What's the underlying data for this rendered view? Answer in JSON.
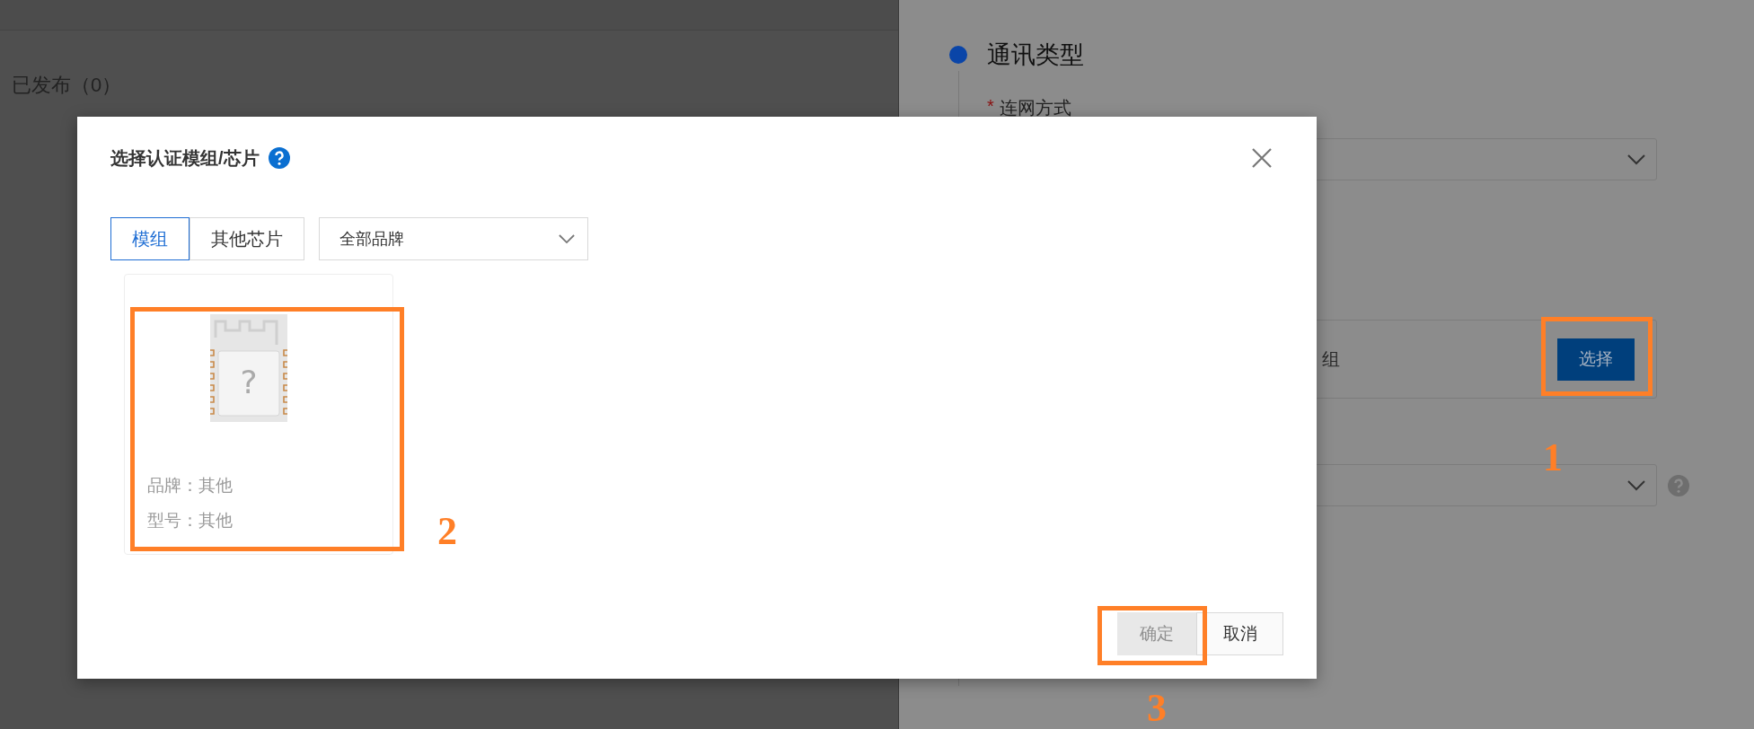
{
  "background": {
    "published_tab": "已发布（0）"
  },
  "side_panel": {
    "section_title": "通讯类型",
    "network_label": {
      "required_mark": "*",
      "text": "连网方式"
    },
    "module_row": {
      "text": "组",
      "button": "选择"
    }
  },
  "dialog": {
    "title": "选择认证模组/芯片",
    "tabs": [
      {
        "label": "模组",
        "selected": true
      },
      {
        "label": "其他芯片",
        "selected": false
      }
    ],
    "brand_filter": {
      "value": "全部品牌"
    },
    "cards": [
      {
        "chip_mark": "?",
        "brand": "品牌：其他",
        "model": "型号：其他"
      }
    ],
    "buttons": [
      {
        "label": "确定",
        "kind": "primary",
        "disabled": true
      },
      {
        "label": "取消",
        "kind": "default",
        "disabled": false
      }
    ]
  },
  "annotations": [
    "1",
    "2",
    "3"
  ]
}
